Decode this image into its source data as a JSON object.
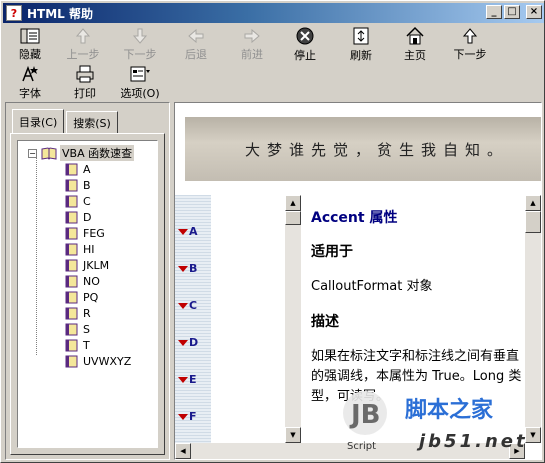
{
  "window": {
    "title": "HTML 帮助"
  },
  "titlebar_buttons": [
    "_",
    "□",
    "×"
  ],
  "toolbar": [
    {
      "key": "hide",
      "label": "隐藏",
      "enabled": true,
      "icon": "hide-icon"
    },
    {
      "key": "prev",
      "label": "上一步",
      "enabled": false,
      "icon": "up-arrow-icon"
    },
    {
      "key": "next_step",
      "label": "下一步",
      "enabled": false,
      "icon": "down-arrow-icon"
    },
    {
      "key": "back",
      "label": "后退",
      "enabled": false,
      "icon": "back-arrow-icon"
    },
    {
      "key": "forward",
      "label": "前进",
      "enabled": false,
      "icon": "forward-arrow-icon"
    },
    {
      "key": "stop",
      "label": "停止",
      "enabled": true,
      "icon": "stop-icon"
    },
    {
      "key": "refresh",
      "label": "刷新",
      "enabled": true,
      "icon": "refresh-icon"
    },
    {
      "key": "home",
      "label": "主页",
      "enabled": true,
      "icon": "home-icon"
    },
    {
      "key": "next",
      "label": "下一步",
      "enabled": true,
      "icon": "up-arrow-icon"
    },
    {
      "key": "font",
      "label": "字体",
      "enabled": true,
      "icon": "font-icon"
    },
    {
      "key": "print",
      "label": "打印",
      "enabled": true,
      "icon": "print-icon"
    },
    {
      "key": "options",
      "label": "选项(O)",
      "enabled": true,
      "icon": "options-icon"
    }
  ],
  "tabs": {
    "contents": "目录(C)",
    "search": "搜索(S)"
  },
  "tree": {
    "root": "VBA 函数速查",
    "items": [
      "A",
      "B",
      "C",
      "D",
      "FEG",
      "HI",
      "JKLM",
      "NO",
      "PQ",
      "R",
      "S",
      "T",
      "UVWXYZ"
    ]
  },
  "banner_text": "大梦谁先觉，贫生我自知。",
  "letters": [
    "A",
    "B",
    "C",
    "D",
    "E",
    "F"
  ],
  "article": {
    "title": "Accent 属性",
    "applies_heading": "适用于",
    "applies_text": "CalloutFormat 对象",
    "desc_heading": "描述",
    "desc_text": "如果在标注文字和标注线之间有垂直的强调线，本属性为 True。Long 类型，可读写。"
  },
  "watermark": {
    "brand": "脚本之家",
    "sub": "Script",
    "url": "jb51.net",
    "logo": "JB"
  },
  "colors": {
    "title_start": "#0a246a",
    "title_end": "#a6caf0",
    "accent_link": "#000080",
    "marker_red": "#c00000"
  }
}
